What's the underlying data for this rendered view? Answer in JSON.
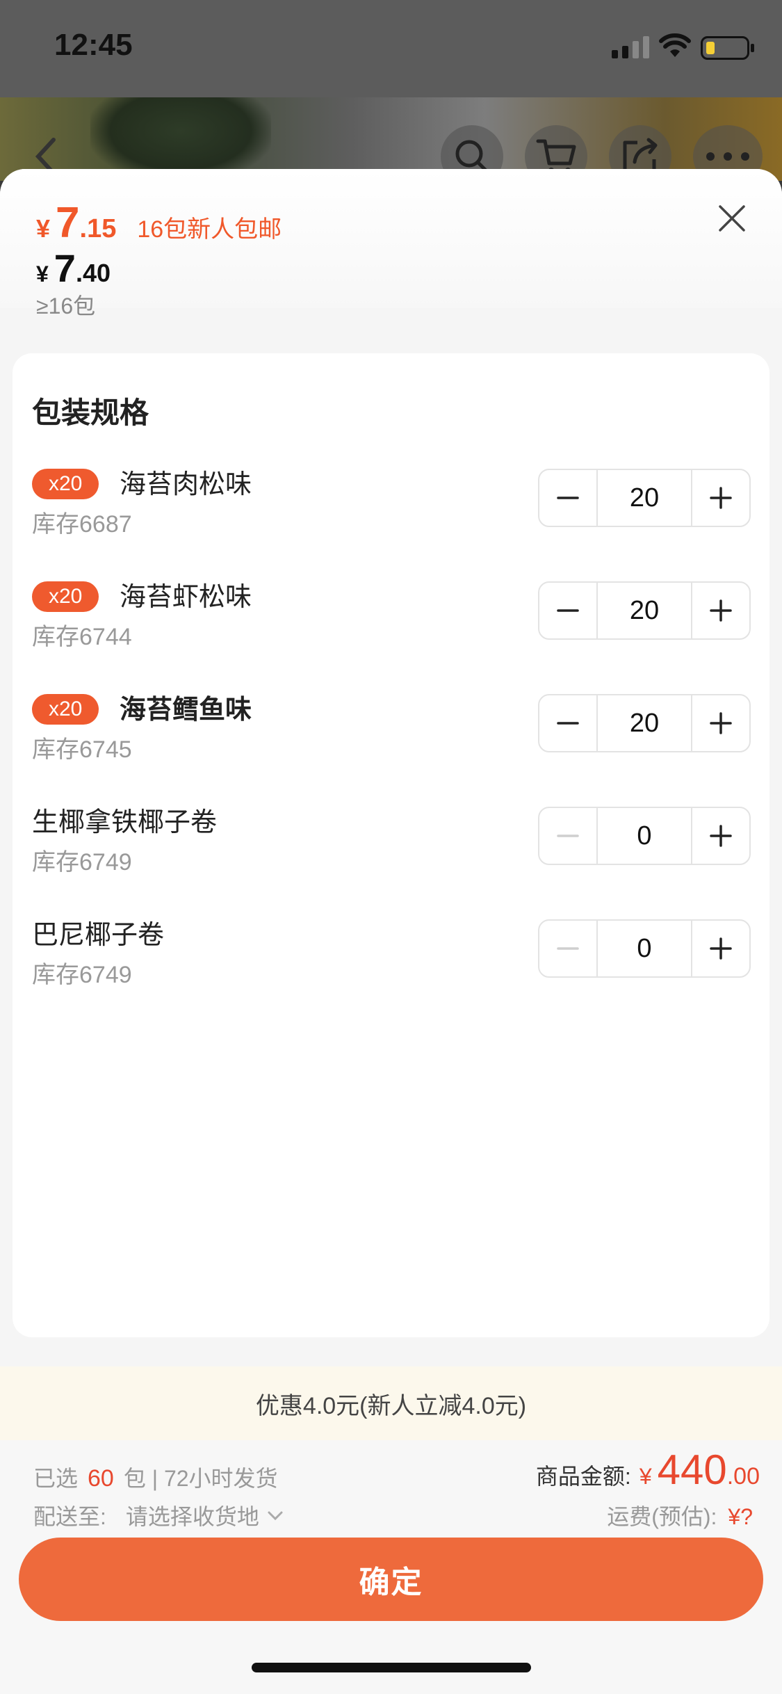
{
  "status_bar": {
    "time": "12:45"
  },
  "header": {
    "promo_price": {
      "currency": "¥",
      "integer": "7",
      "decimal": ".15",
      "note": "16包新人包邮"
    },
    "price": {
      "currency": "¥",
      "integer": "7",
      "decimal": ".40"
    },
    "min_qty": "≥16包"
  },
  "spec_section": {
    "title": "包装规格",
    "items": [
      {
        "badge": "x20",
        "name": "海苔肉松味",
        "stock": "库存6687",
        "qty": "20"
      },
      {
        "badge": "x20",
        "name": "海苔虾松味",
        "stock": "库存6744",
        "qty": "20"
      },
      {
        "badge": "x20",
        "name": "海苔鳕鱼味",
        "stock": "库存6745",
        "qty": "20"
      },
      {
        "badge": "",
        "name": "生椰拿铁椰子卷",
        "stock": "库存6749",
        "qty": "0"
      },
      {
        "badge": "",
        "name": "巴尼椰子卷",
        "stock": "库存6749",
        "qty": "0"
      }
    ]
  },
  "promo_text": "优惠4.0元(新人立减4.0元)",
  "footer": {
    "selected_prefix": "已选",
    "selected_count": "60",
    "selected_suffix": "包 | 72小时发货",
    "ship_label": "配送至:",
    "ship_value": "请选择收货地",
    "amount_label": "商品金额:",
    "amount_currency": "¥",
    "amount_integer": "440",
    "amount_decimal": ".00",
    "freight_label": "运费(预估):",
    "freight_value": "¥?",
    "confirm_label": "确定"
  },
  "colors": {
    "accent": "#ee6a3c",
    "price": "#f0582a",
    "badge": "#ef5a2e"
  },
  "icons": [
    "back-icon",
    "search-icon",
    "cart-icon",
    "share-icon",
    "more-icon",
    "close-icon",
    "minus-icon",
    "plus-icon",
    "chevron-down-icon"
  ]
}
